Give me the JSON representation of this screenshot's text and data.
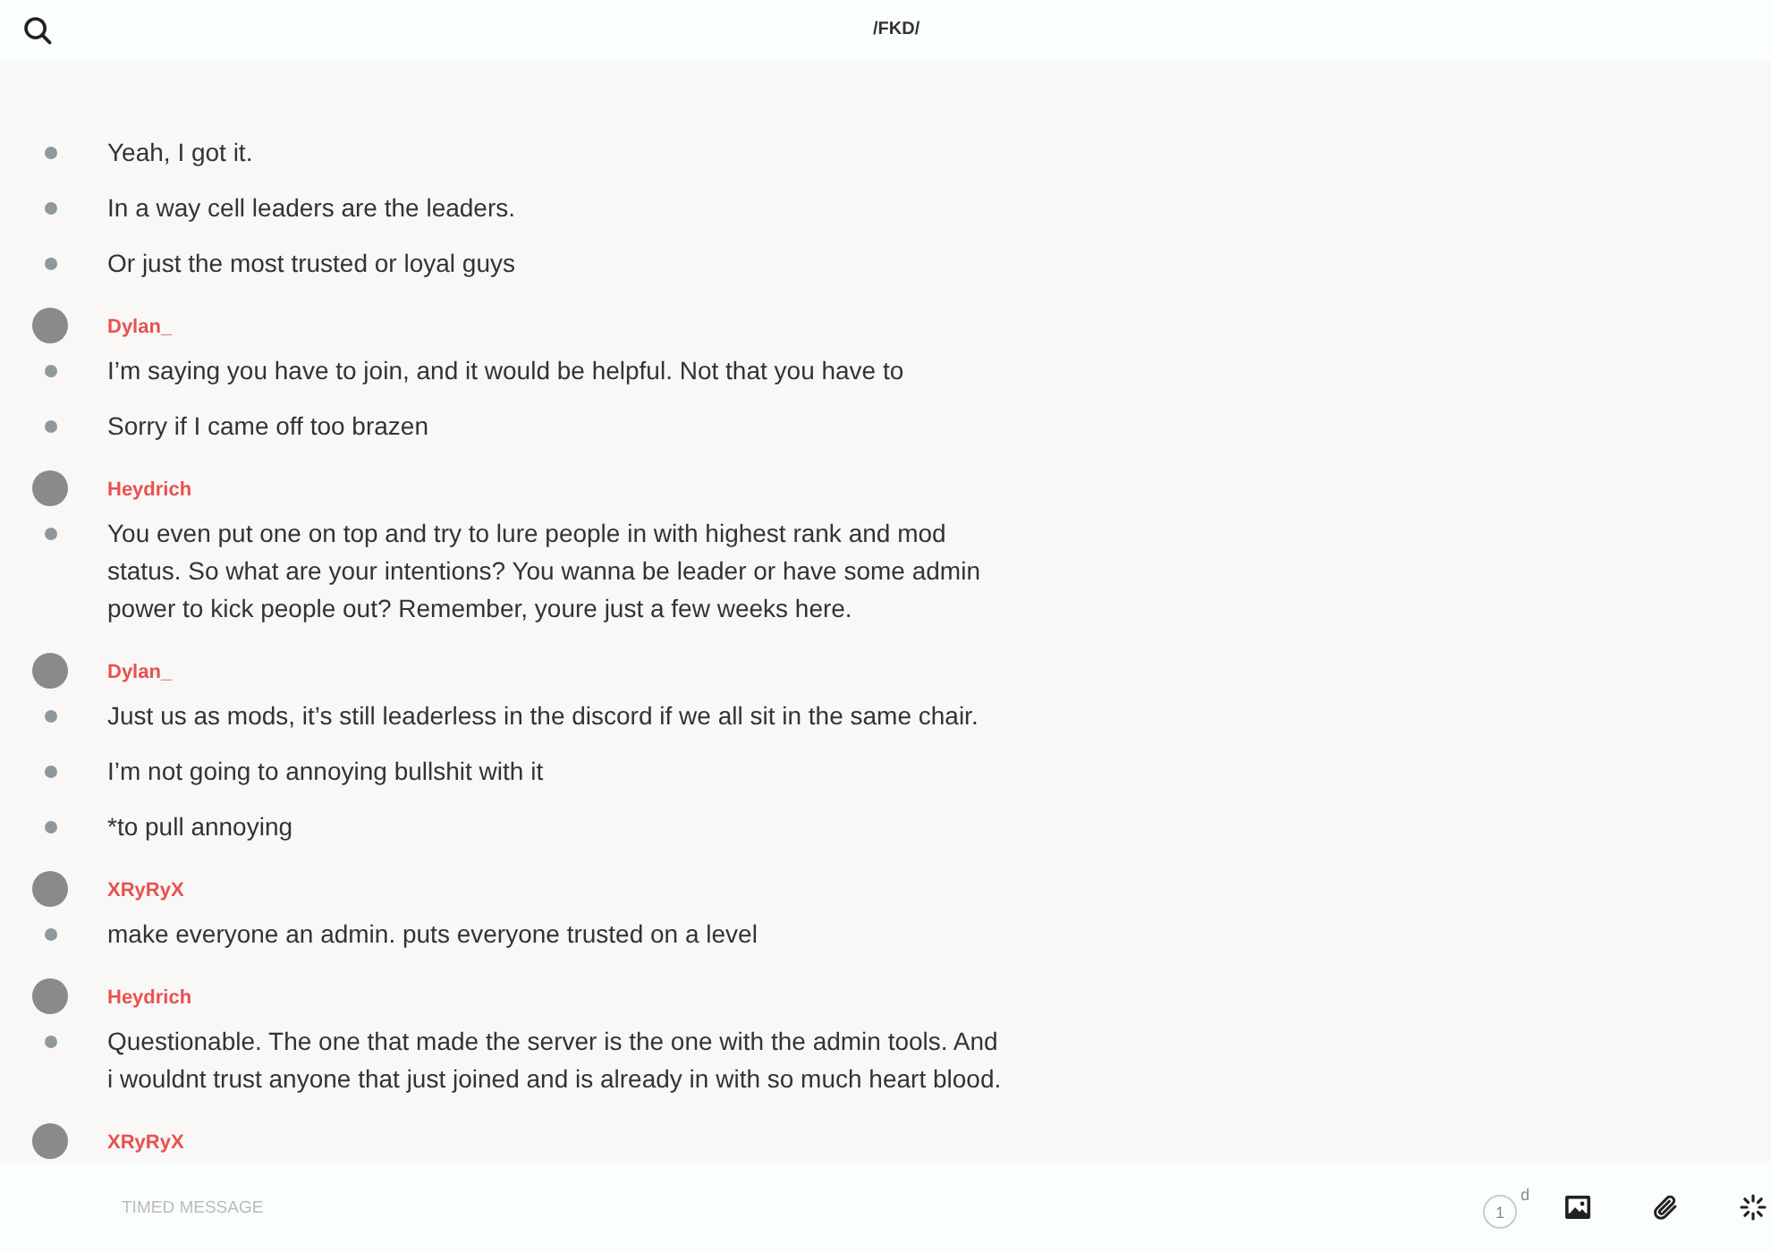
{
  "header": {
    "title": "/FKD/"
  },
  "groups": [
    {
      "messages": [
        "Yeah, I got it.",
        "In a way cell leaders are the leaders.",
        "Or just the most trusted or loyal guys"
      ]
    },
    {
      "author": "Dylan_",
      "color": "#e8514f",
      "messages": [
        "I’m saying you have to join, and it would be helpful. Not that you have to",
        "Sorry if I came off too brazen"
      ]
    },
    {
      "author": "Heydrich",
      "color": "#e8514f",
      "messages": [
        "You even put one on top and try to lure people in with highest rank and mod status. So what are your intentions? You wanna be leader or have some admin power to kick people out? Remember, youre just a few weeks here."
      ]
    },
    {
      "author": "Dylan_",
      "color": "#e8514f",
      "messages": [
        "Just us as mods, it’s still leaderless in the discord if we all sit in the same chair.",
        "I’m not going to annoying bullshit with it",
        "*to pull annoying"
      ]
    },
    {
      "author": "XRyRyX",
      "color": "#e8514f",
      "messages": [
        "make everyone an admin. puts everyone trusted on a level"
      ]
    },
    {
      "author": "Heydrich",
      "color": "#e8514f",
      "messages": [
        "Questionable. The one that made the server is the one with the admin tools. And i wouldnt trust anyone that just joined and is already in with so much heart blood."
      ]
    },
    {
      "author": "XRyRyX",
      "color": "#e8514f"
    }
  ],
  "composer": {
    "placeholder": "TIMED MESSAGE",
    "timer": {
      "value": "1",
      "unit": "d"
    }
  }
}
